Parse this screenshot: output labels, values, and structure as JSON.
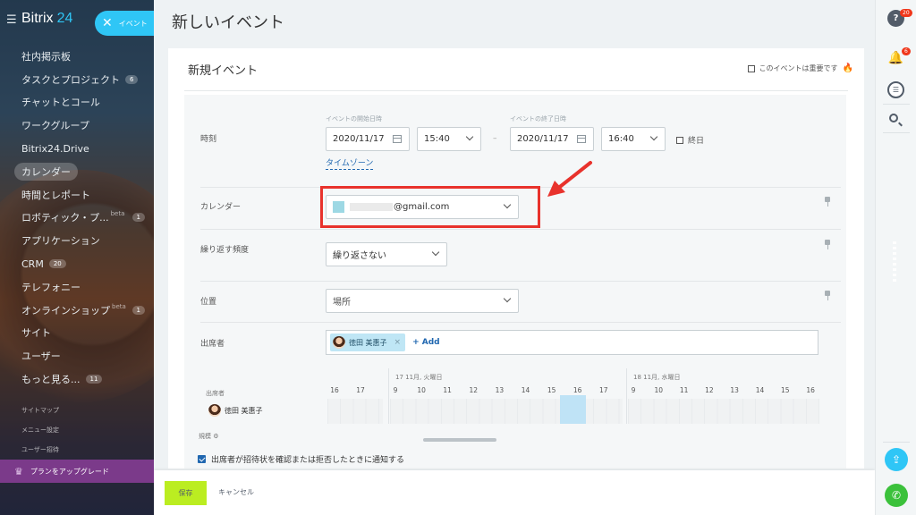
{
  "sidebar": {
    "logo": "Bitrix",
    "logo_number": "24",
    "event_pill_label": "イベント",
    "items": [
      {
        "label": "社内掲示板",
        "badge": ""
      },
      {
        "label": "タスクとプロジェクト",
        "badge": "6"
      },
      {
        "label": "チャットとコール",
        "badge": ""
      },
      {
        "label": "ワークグループ",
        "badge": ""
      },
      {
        "label": "Bitrix24.Drive",
        "badge": ""
      },
      {
        "label": "カレンダー",
        "badge": ""
      },
      {
        "label": "時間とレポート",
        "badge": ""
      },
      {
        "label": "ロボティック・プ...",
        "badge": "1",
        "beta": "beta"
      },
      {
        "label": "アプリケーション",
        "badge": ""
      },
      {
        "label": "CRM",
        "badge": "20"
      },
      {
        "label": "テレフォニー",
        "badge": ""
      },
      {
        "label": "オンラインショップ",
        "badge": "1",
        "beta": "beta"
      },
      {
        "label": "サイト",
        "badge": ""
      },
      {
        "label": "ユーザー",
        "badge": ""
      },
      {
        "label": "もっと見る...",
        "badge": "11"
      }
    ],
    "small_links": [
      "サイトマップ",
      "メニュー設定",
      "ユーザー招待"
    ],
    "upgrade_label": "プランをアップグレード"
  },
  "page": {
    "title": "新しいイベント",
    "card_title": "新規イベント",
    "important_label": "このイベントは重要です"
  },
  "form": {
    "time_label": "時刻",
    "start_caption": "イベントの開始日時",
    "end_caption": "イベントの終了日時",
    "start_date": "2020/11/17",
    "start_time": "15:40",
    "end_date": "2020/11/17",
    "end_time": "16:40",
    "allday_label": "終日",
    "dash": "–",
    "timezone_link": "タイムゾーン",
    "calendar_label": "カレンダー",
    "calendar_value": "@gmail.com",
    "repeat_label": "繰り返す頻度",
    "repeat_value": "繰り返さない",
    "location_label": "位置",
    "location_placeholder": "場所",
    "attendees_label": "出席者",
    "attendee_name": "徳田 美惠子",
    "add_label": "+ Add",
    "notify_label": "出席者が招待状を確認または拒否したときに通知する"
  },
  "timeline": {
    "day1_label": "17 11月, 火曜日",
    "day2_label": "18 11月, 水曜日",
    "hours_prev": [
      "16",
      "17"
    ],
    "hours_day1": [
      "9",
      "10",
      "11",
      "12",
      "13",
      "14",
      "15",
      "16",
      "17"
    ],
    "hours_day2": [
      "9",
      "10",
      "11",
      "12",
      "13",
      "14",
      "15",
      "16"
    ],
    "attendees_caption": "出席者",
    "attendee_name": "徳田 美惠子",
    "scale_label": "規模"
  },
  "footer": {
    "save_label": "保存",
    "cancel_label": "キャンセル"
  },
  "rightbar": {
    "help_badge": "20",
    "notify_badge": "6"
  },
  "colors": {
    "accent": "#2fc6f6",
    "save_button": "#bbed21",
    "highlight": "#e8322c",
    "link": "#2067b0",
    "upgrade": "#7b3a8a"
  }
}
